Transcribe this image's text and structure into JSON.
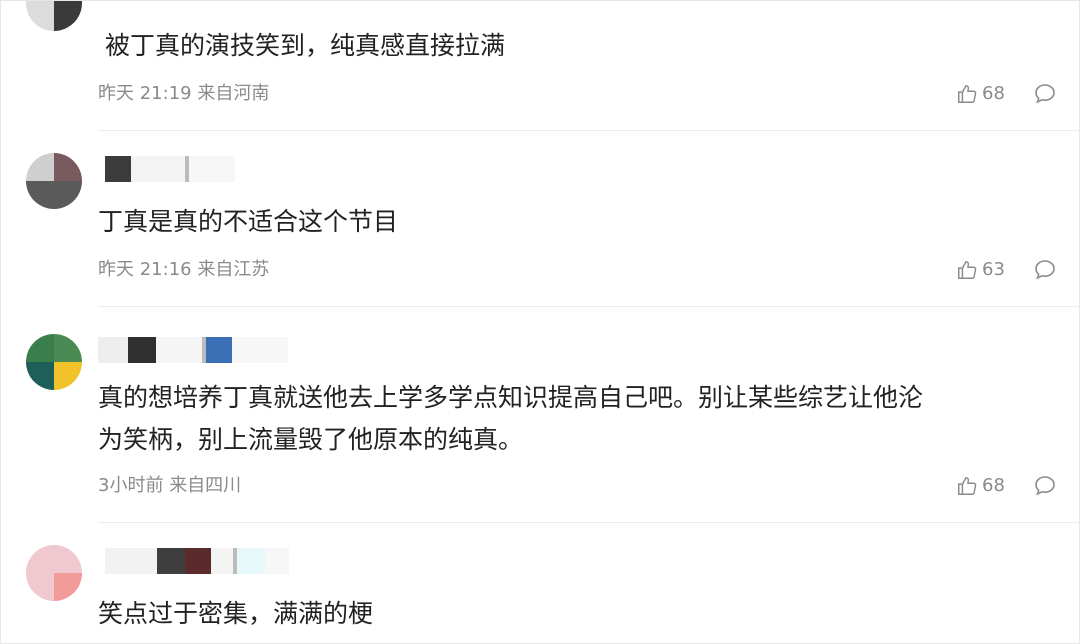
{
  "comments": [
    {
      "text": "被丁真的演技笑到，纯真感直接拉满",
      "time": "昨天 21:19",
      "location": "来自河南",
      "likes": "68"
    },
    {
      "text": "丁真是真的不适合这个节目",
      "time": "昨天 21:16",
      "location": "来自江苏",
      "likes": "63"
    },
    {
      "text_line1": "真的想培养丁真就送他去上学多学点知识提高自己吧。别让某些综艺让他沦",
      "text_line2": "为笑柄，别上流量毁了他原本的纯真。",
      "time": "3小时前",
      "location": "来自四川",
      "likes": "68"
    },
    {
      "text": "笑点过于密集，满满的梗"
    }
  ],
  "icons": {
    "like": "thumbs-up-icon",
    "reply": "speech-bubble-icon"
  },
  "colors": {
    "text": "#222222",
    "meta": "#8a8a8a",
    "divider": "#ececec"
  }
}
